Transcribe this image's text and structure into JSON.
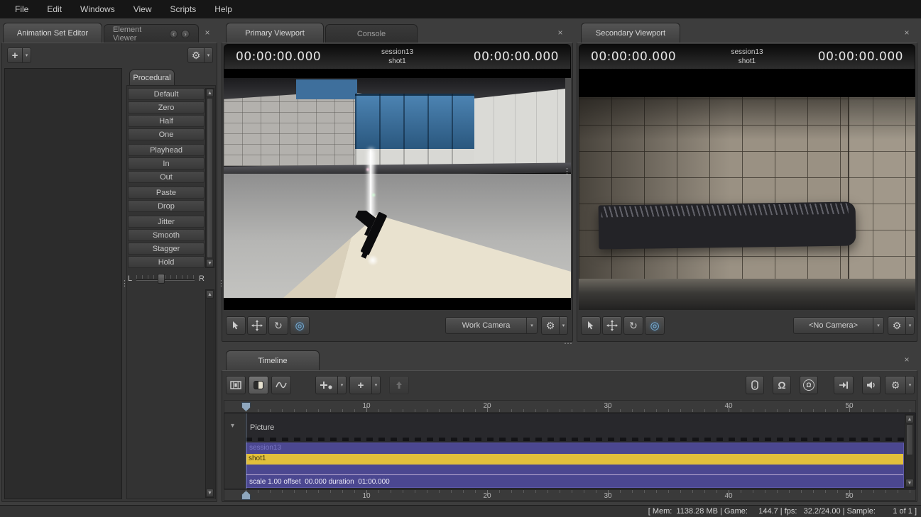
{
  "menu": {
    "items": [
      "File",
      "Edit",
      "Windows",
      "View",
      "Scripts",
      "Help"
    ]
  },
  "icons": {
    "gear": "⚙",
    "plus": "+",
    "rotate": "↻",
    "orbit": "◎",
    "magnet": "Ω",
    "history_back": "‹",
    "history_forward": "›",
    "close": "×",
    "dropdown": "▾",
    "expander": "▾",
    "scroll_up": "▲",
    "scroll_down": "▼",
    "dots_v": "⋮",
    "dots_h": "⋯"
  },
  "left_panel": {
    "tabs": {
      "animation_set_editor": "Animation Set Editor",
      "element_viewer": "Element Viewer"
    },
    "procedural": {
      "tab_label": "Procedural",
      "presets": [
        "Default",
        "Zero",
        "Half",
        "One",
        "Playhead",
        "In",
        "Out",
        "Paste",
        "Drop",
        "Jitter",
        "Smooth",
        "Stagger",
        "Hold"
      ],
      "slider": {
        "left": "L",
        "right": "R"
      }
    }
  },
  "primary_panel": {
    "tabs": {
      "primary": "Primary Viewport",
      "console": "Console"
    },
    "timecode": {
      "left": "00:00:00.000",
      "session": "session13",
      "shot": "shot1",
      "right": "00:00:00.000"
    },
    "camera": "Work Camera"
  },
  "secondary_panel": {
    "tab": "Secondary Viewport",
    "timecode": {
      "left": "00:00:00.000",
      "session": "session13",
      "shot": "shot1",
      "right": "00:00:00.000"
    },
    "camera": "<No Camera>"
  },
  "timeline": {
    "tab": "Timeline",
    "ruler_ticks": [
      "10",
      "20",
      "30",
      "40",
      "50"
    ],
    "track": {
      "label": "Picture",
      "clip_session": "session13",
      "clip_shot": "shot1",
      "clip_info": "scale 1.00 offset  00.000 duration  01:00.000"
    }
  },
  "status_bar": {
    "text": "[ Mem:  1138.28 MB | Game:     144.7 | fps:   32.2/24.00 | Sample:        1 of 1 ]"
  },
  "colors": {
    "clip_purple": "#4b4790",
    "clip_yellow": "#e2bf3b",
    "accent_blue": "#7fb8e0"
  }
}
